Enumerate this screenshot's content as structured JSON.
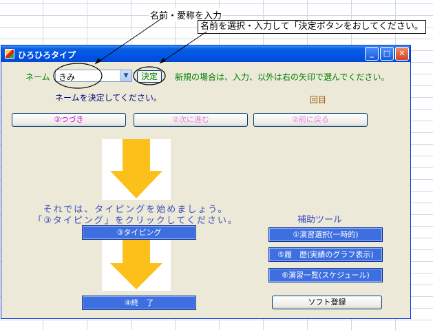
{
  "annotations": {
    "name_note": "名前・愛称を入力",
    "select_note": "名前を選択・入力して「決定ボタンをおしてください。"
  },
  "window": {
    "title": "ひろひろタイプ",
    "controls": {
      "minimize": "_",
      "maximize": "□",
      "close": "✕"
    }
  },
  "name_section": {
    "label": "ネーム",
    "selected_value": "きみ",
    "decide_label": "決定",
    "new_hint": "新規の場合は、入力、以外は右の矢印で選んでください。",
    "decide_hint": "ネームを決定してください。",
    "count_label": "回目"
  },
  "nav_buttons": {
    "continue": "②つづき",
    "next": "②次に進む",
    "prev": "②前に戻る"
  },
  "instructions": {
    "line1": "それでは、タイピングを始めましょう。",
    "line2": "「③タイピング」をクリックしてください。"
  },
  "main_buttons": {
    "typing": "③タイピング",
    "end": "④終　了"
  },
  "tools": {
    "label": "補助ツール",
    "select": "①演習選択(一時的)",
    "history": "⑤履　歴(実績のグラフ表示)",
    "list": "⑥演習一覧(スケジュール)",
    "register": "ソフト登録"
  },
  "colors": {
    "arrow": "#fbc01a",
    "green_text": "#008000",
    "title_blue": "#0055e5",
    "button_blue": "#3d6fe0"
  }
}
